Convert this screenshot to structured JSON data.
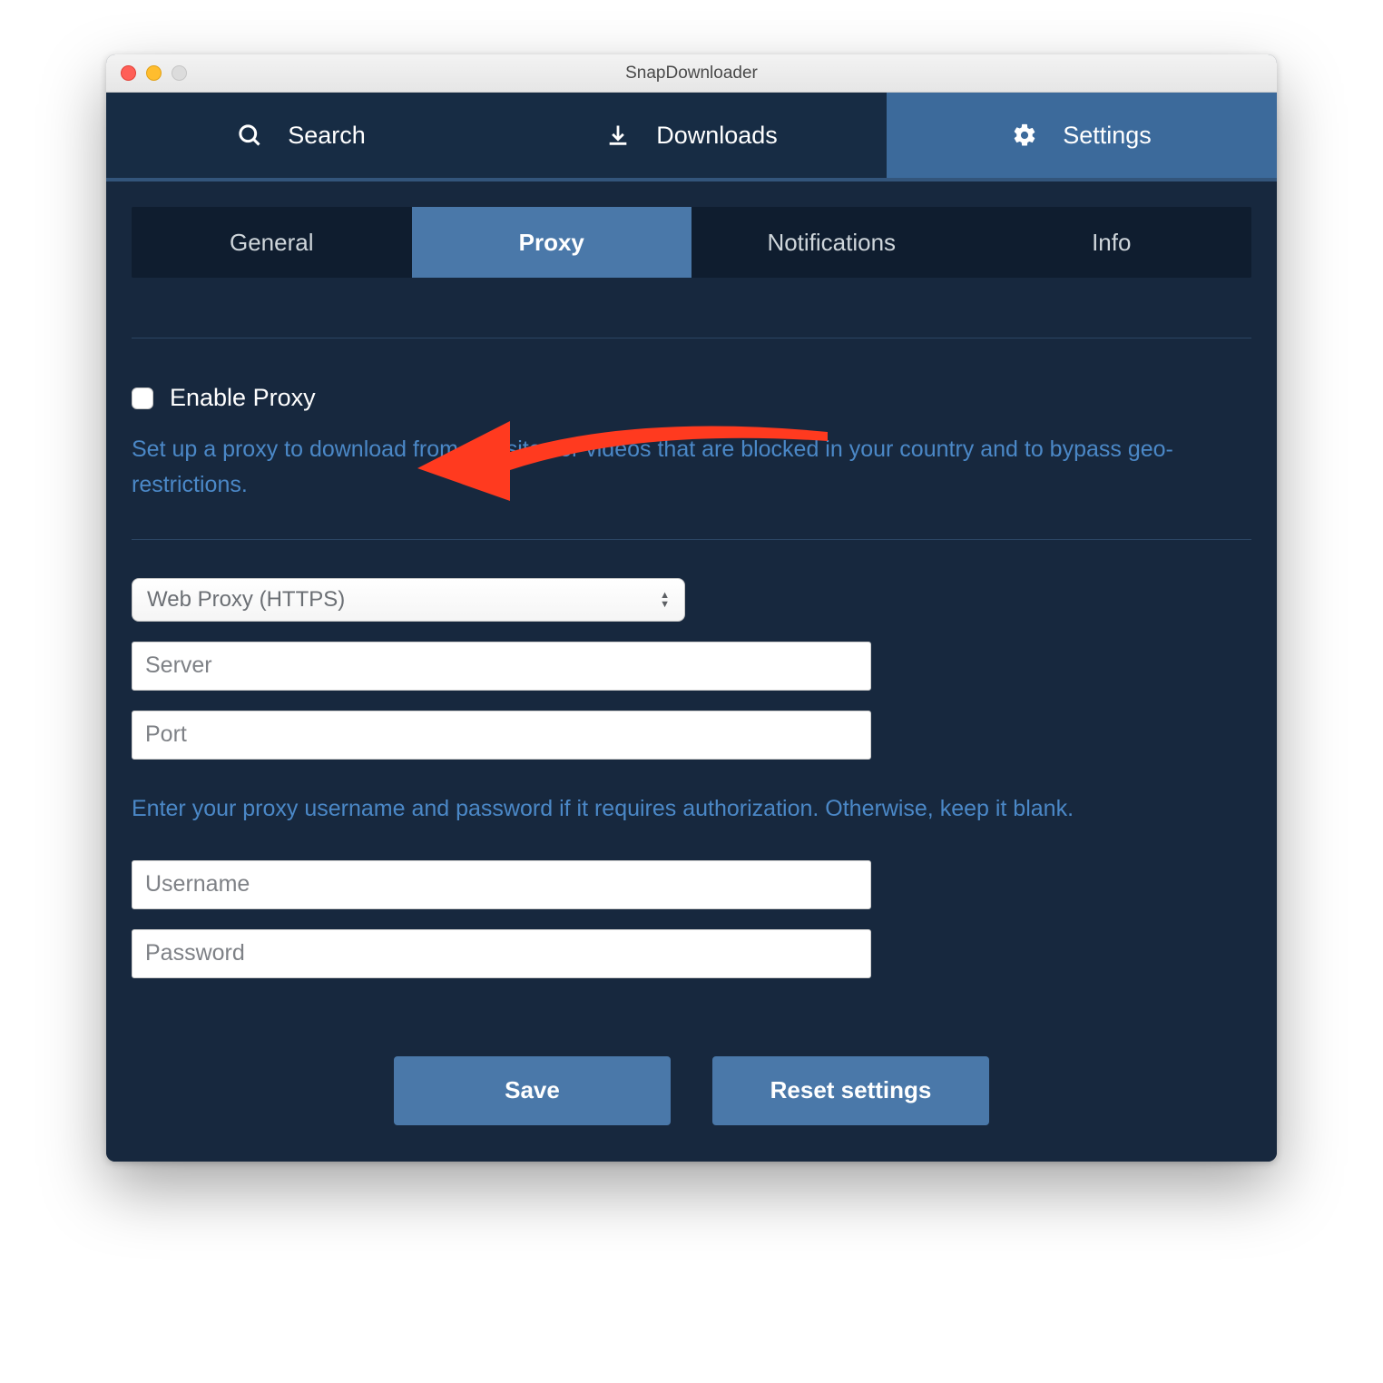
{
  "titlebar": {
    "title": "SnapDownloader"
  },
  "nav": {
    "search_label": "Search",
    "downloads_label": "Downloads",
    "settings_label": "Settings"
  },
  "sub_tabs": {
    "general": "General",
    "proxy": "Proxy",
    "notifications": "Notifications",
    "info": "Info"
  },
  "proxy": {
    "enable_label": "Enable Proxy",
    "description": "Set up a proxy to download from websites or videos that are blocked in your country and to bypass geo-restrictions.",
    "type_selected": "Web Proxy (HTTPS)",
    "server_placeholder": "Server",
    "port_placeholder": "Port",
    "auth_description": "Enter your proxy username and password if it requires authorization. Otherwise, keep it blank.",
    "username_placeholder": "Username",
    "password_placeholder": "Password"
  },
  "actions": {
    "save": "Save",
    "reset": "Reset settings"
  }
}
